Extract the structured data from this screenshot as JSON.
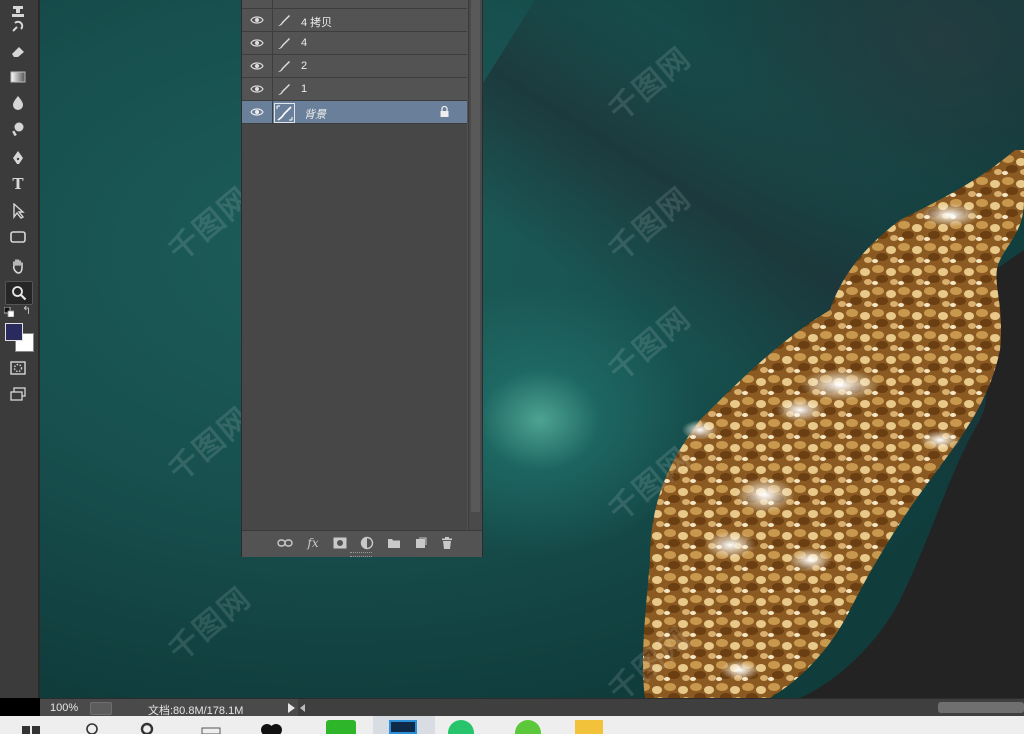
{
  "app": "Photoshop",
  "toolbar": {
    "tools": [
      {
        "name": "clone-stamp-icon"
      },
      {
        "name": "history-brush-icon"
      },
      {
        "name": "eraser-icon"
      },
      {
        "name": "gradient-icon"
      },
      {
        "name": "blur-icon"
      },
      {
        "name": "dodge-icon"
      },
      {
        "name": "pen-icon"
      },
      {
        "name": "type-icon",
        "glyph": "T"
      },
      {
        "name": "path-selection-icon"
      },
      {
        "name": "rectangle-shape-icon"
      },
      {
        "name": "hand-icon"
      },
      {
        "name": "zoom-icon",
        "active": true
      },
      {
        "name": "quick-mask-icon"
      },
      {
        "name": "screen-mode-icon"
      }
    ],
    "foreground_color": "#2a2a5e",
    "background_color": "#ffffff"
  },
  "layers_panel": {
    "layers": [
      {
        "name": "4 拷贝",
        "type": "paint",
        "visible": true,
        "selected": false
      },
      {
        "name": "4",
        "type": "paint",
        "visible": true,
        "selected": false
      },
      {
        "name": "2",
        "type": "paint",
        "visible": true,
        "selected": false
      },
      {
        "name": "1",
        "type": "paint",
        "visible": true,
        "selected": false
      },
      {
        "name": "背景",
        "type": "background",
        "visible": true,
        "selected": true,
        "locked": true
      }
    ],
    "footer_icons": [
      "link-layers-icon",
      "fx-icon",
      "add-mask-icon",
      "adjustment-layer-icon",
      "new-group-icon",
      "new-layer-icon",
      "delete-layer-icon"
    ],
    "fx_label": "fx"
  },
  "statusbar": {
    "zoom": "100%",
    "doc_size": "文档:80.8M/178.1M"
  },
  "watermark_text": "千图网",
  "colors": {
    "selected_layer": "#6a7f99",
    "panel_bg": "#474747"
  }
}
